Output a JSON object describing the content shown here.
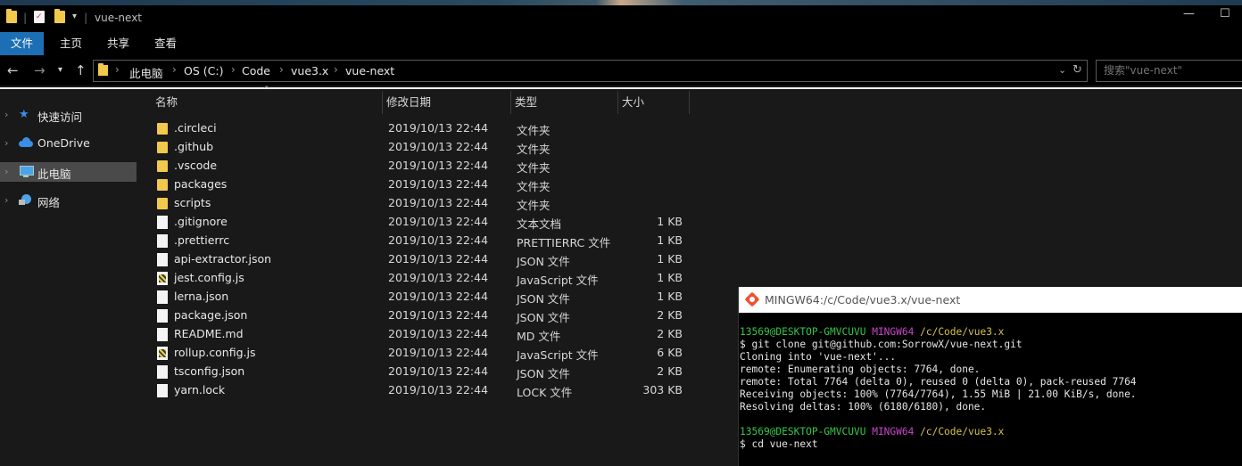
{
  "window": {
    "title": "vue-next"
  },
  "ribbon": {
    "tabs": [
      "文件",
      "主页",
      "共享",
      "查看"
    ]
  },
  "address": {
    "crumbs": [
      "此电脑",
      "OS (C:)",
      "Code",
      "vue3.x",
      "vue-next"
    ]
  },
  "search": {
    "placeholder": "搜索\"vue-next\""
  },
  "nav": {
    "items": [
      {
        "label": "快速访问",
        "icon": "star-icon",
        "selected": false
      },
      {
        "label": "OneDrive",
        "icon": "cloud-icon",
        "selected": false
      },
      {
        "label": "此电脑",
        "icon": "computer-icon",
        "selected": true
      },
      {
        "label": "网络",
        "icon": "network-icon",
        "selected": false
      }
    ]
  },
  "columns": {
    "name": "名称",
    "date": "修改日期",
    "type": "类型",
    "size": "大小"
  },
  "files": [
    {
      "name": ".circleci",
      "date": "2019/10/13 22:44",
      "type": "文件夹",
      "size": "",
      "icon": "folder"
    },
    {
      "name": ".github",
      "date": "2019/10/13 22:44",
      "type": "文件夹",
      "size": "",
      "icon": "folder"
    },
    {
      "name": ".vscode",
      "date": "2019/10/13 22:44",
      "type": "文件夹",
      "size": "",
      "icon": "folder"
    },
    {
      "name": "packages",
      "date": "2019/10/13 22:44",
      "type": "文件夹",
      "size": "",
      "icon": "folder"
    },
    {
      "name": "scripts",
      "date": "2019/10/13 22:44",
      "type": "文件夹",
      "size": "",
      "icon": "folder"
    },
    {
      "name": ".gitignore",
      "date": "2019/10/13 22:44",
      "type": "文本文档",
      "size": "1 KB",
      "icon": "file"
    },
    {
      "name": ".prettierrc",
      "date": "2019/10/13 22:44",
      "type": "PRETTIERRC 文件",
      "size": "1 KB",
      "icon": "file"
    },
    {
      "name": "api-extractor.json",
      "date": "2019/10/13 22:44",
      "type": "JSON 文件",
      "size": "1 KB",
      "icon": "file"
    },
    {
      "name": "jest.config.js",
      "date": "2019/10/13 22:44",
      "type": "JavaScript 文件",
      "size": "1 KB",
      "icon": "js"
    },
    {
      "name": "lerna.json",
      "date": "2019/10/13 22:44",
      "type": "JSON 文件",
      "size": "1 KB",
      "icon": "file"
    },
    {
      "name": "package.json",
      "date": "2019/10/13 22:44",
      "type": "JSON 文件",
      "size": "2 KB",
      "icon": "file"
    },
    {
      "name": "README.md",
      "date": "2019/10/13 22:44",
      "type": "MD 文件",
      "size": "2 KB",
      "icon": "file"
    },
    {
      "name": "rollup.config.js",
      "date": "2019/10/13 22:44",
      "type": "JavaScript 文件",
      "size": "6 KB",
      "icon": "js"
    },
    {
      "name": "tsconfig.json",
      "date": "2019/10/13 22:44",
      "type": "JSON 文件",
      "size": "2 KB",
      "icon": "file"
    },
    {
      "name": "yarn.lock",
      "date": "2019/10/13 22:44",
      "type": "LOCK 文件",
      "size": "303 KB",
      "icon": "file"
    }
  ],
  "terminal": {
    "title": "MINGW64:/c/Code/vue3.x/vue-next",
    "prompt1": {
      "user": "13569@DESKTOP-GMVCUVU",
      "env": "MINGW64",
      "path": "/c/Code/vue3.x"
    },
    "cmd1": "$ git clone git@github.com:SorrowX/vue-next.git",
    "output": [
      "Cloning into 'vue-next'...",
      "remote: Enumerating objects: 7764, done.",
      "remote: Total 7764 (delta 0), reused 0 (delta 0), pack-reused 7764",
      "Receiving objects: 100% (7764/7764), 1.55 MiB | 21.00 KiB/s, done.",
      "Resolving deltas: 100% (6180/6180), done."
    ],
    "prompt2": {
      "user": "13569@DESKTOP-GMVCUVU",
      "env": "MINGW64",
      "path": "/c/Code/vue3.x"
    },
    "cmd2": "$ cd vue-next"
  }
}
